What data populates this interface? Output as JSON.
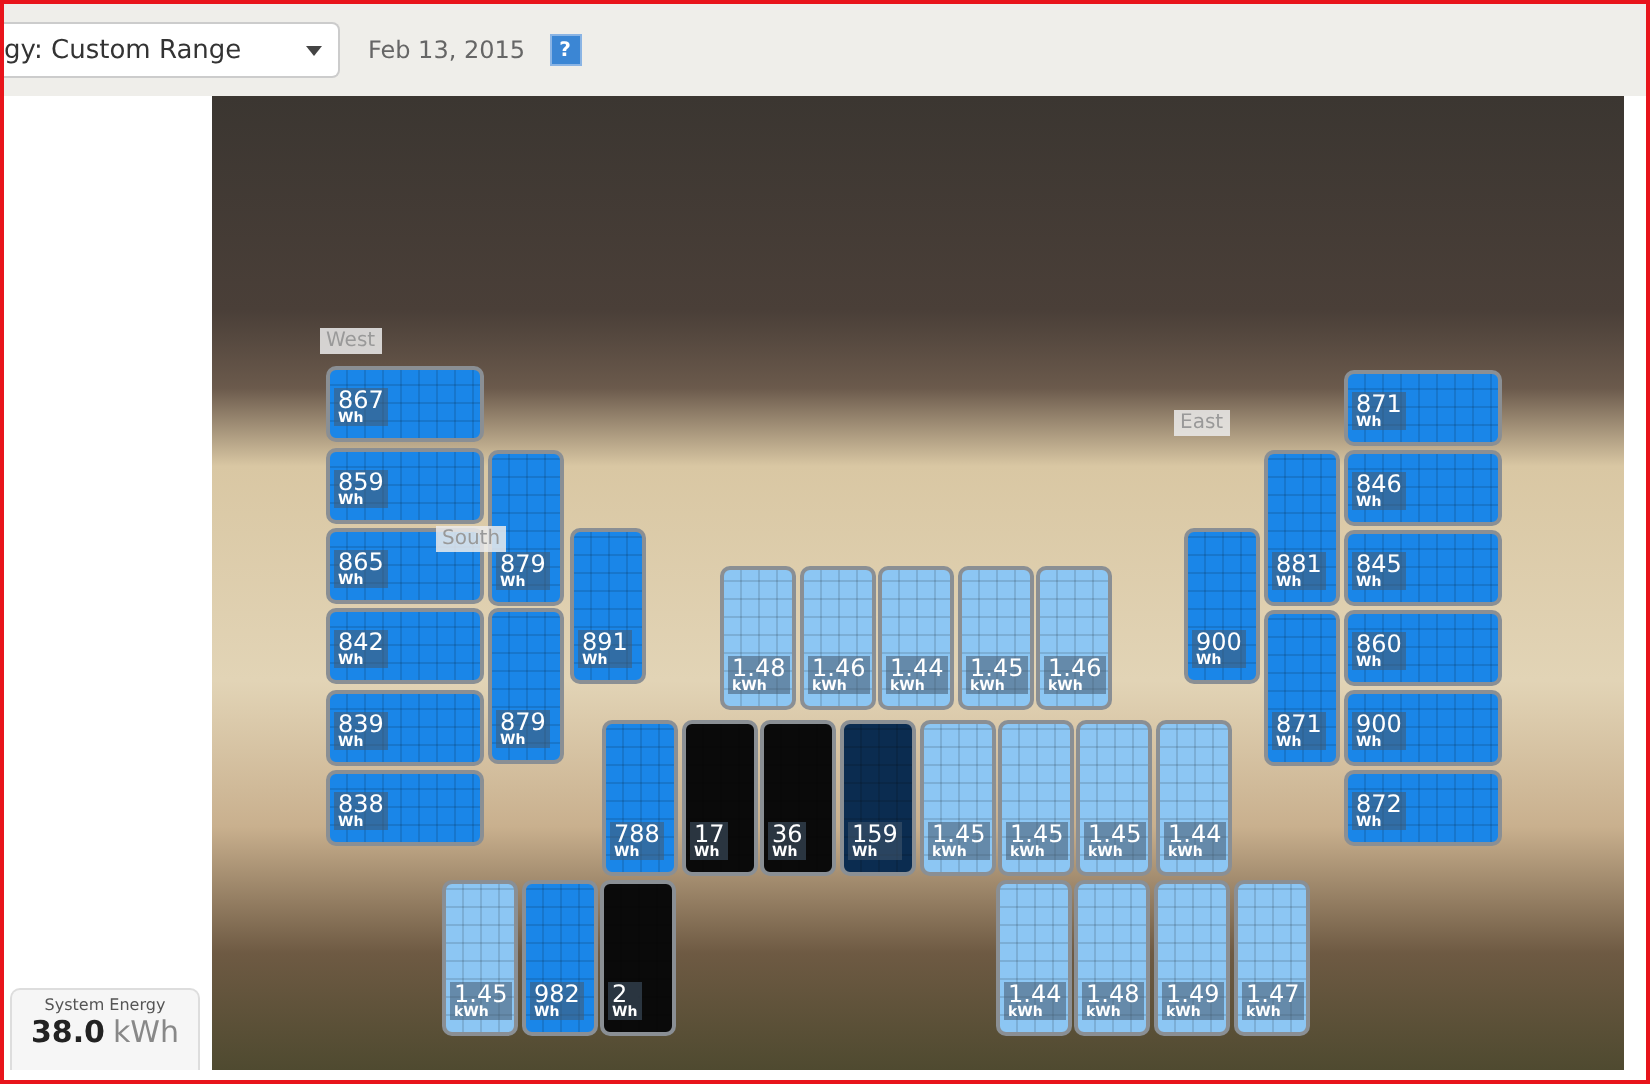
{
  "toolbar": {
    "range_dropdown": {
      "value": "gy: Custom Range"
    },
    "date": "Feb 13, 2015",
    "help_icon": "?"
  },
  "photo_labels": [
    "West",
    "South",
    "East"
  ],
  "panels": [
    {
      "value": "867",
      "unit": "Wh",
      "color": "#1a86e8"
    },
    {
      "value": "859",
      "unit": "Wh",
      "color": "#1a86e8"
    },
    {
      "value": "865",
      "unit": "Wh",
      "color": "#1a86e8"
    },
    {
      "value": "842",
      "unit": "Wh",
      "color": "#1a86e8"
    },
    {
      "value": "839",
      "unit": "Wh",
      "color": "#1a86e8"
    },
    {
      "value": "838",
      "unit": "Wh",
      "color": "#1a86e8"
    },
    {
      "value": "879",
      "unit": "Wh",
      "color": "#1a86e8"
    },
    {
      "value": "879",
      "unit": "Wh",
      "color": "#1a86e8"
    },
    {
      "value": "891",
      "unit": "Wh",
      "color": "#1a86e8"
    },
    {
      "value": "1.48",
      "unit": "kWh",
      "color": "#8cc6f3"
    },
    {
      "value": "1.46",
      "unit": "kWh",
      "color": "#8cc6f3"
    },
    {
      "value": "1.44",
      "unit": "kWh",
      "color": "#8cc6f3"
    },
    {
      "value": "1.45",
      "unit": "kWh",
      "color": "#8cc6f3"
    },
    {
      "value": "1.46",
      "unit": "kWh",
      "color": "#8cc6f3"
    },
    {
      "value": "788",
      "unit": "Wh",
      "color": "#1a86e8"
    },
    {
      "value": "17",
      "unit": "Wh",
      "color": "#0a0a0a"
    },
    {
      "value": "36",
      "unit": "Wh",
      "color": "#0a0a0a"
    },
    {
      "value": "159",
      "unit": "Wh",
      "color": "#0b2c50"
    },
    {
      "value": "1.45",
      "unit": "kWh",
      "color": "#8cc6f3"
    },
    {
      "value": "1.45",
      "unit": "kWh",
      "color": "#8cc6f3"
    },
    {
      "value": "1.45",
      "unit": "kWh",
      "color": "#8cc6f3"
    },
    {
      "value": "1.44",
      "unit": "kWh",
      "color": "#8cc6f3"
    },
    {
      "value": "1.45",
      "unit": "kWh",
      "color": "#8cc6f3"
    },
    {
      "value": "982",
      "unit": "Wh",
      "color": "#1a86e8"
    },
    {
      "value": "2",
      "unit": "Wh",
      "color": "#0a0a0a"
    },
    {
      "value": "1.44",
      "unit": "kWh",
      "color": "#8cc6f3"
    },
    {
      "value": "1.48",
      "unit": "kWh",
      "color": "#8cc6f3"
    },
    {
      "value": "1.49",
      "unit": "kWh",
      "color": "#8cc6f3"
    },
    {
      "value": "1.47",
      "unit": "kWh",
      "color": "#8cc6f3"
    },
    {
      "value": "900",
      "unit": "Wh",
      "color": "#1a86e8"
    },
    {
      "value": "881",
      "unit": "Wh",
      "color": "#1a86e8"
    },
    {
      "value": "871",
      "unit": "Wh",
      "color": "#1a86e8"
    },
    {
      "value": "871",
      "unit": "Wh",
      "color": "#1a86e8"
    },
    {
      "value": "846",
      "unit": "Wh",
      "color": "#1a86e8"
    },
    {
      "value": "845",
      "unit": "Wh",
      "color": "#1a86e8"
    },
    {
      "value": "860",
      "unit": "Wh",
      "color": "#1a86e8"
    },
    {
      "value": "900",
      "unit": "Wh",
      "color": "#1a86e8"
    },
    {
      "value": "872",
      "unit": "Wh",
      "color": "#1a86e8"
    }
  ],
  "system_energy": {
    "label": "System Energy",
    "value": "38.0",
    "unit": "kWh"
  }
}
